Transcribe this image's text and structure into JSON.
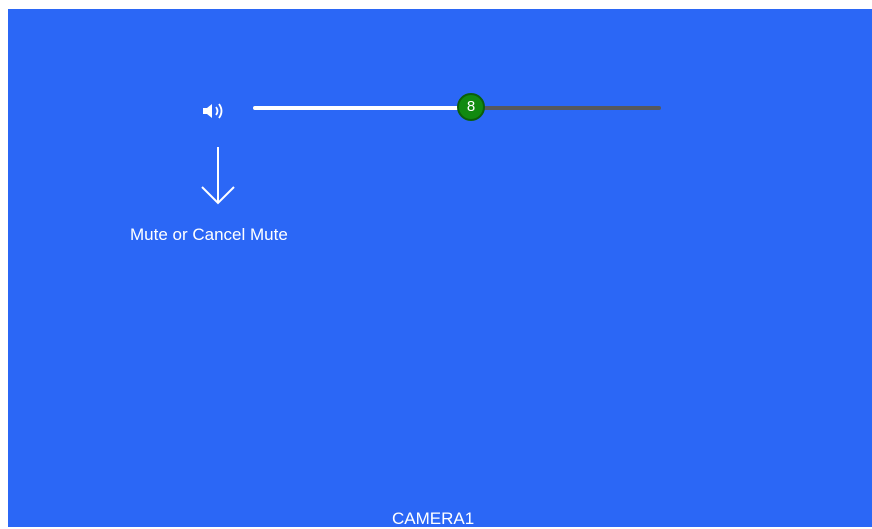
{
  "volume": {
    "icon": "speaker-icon",
    "level": 8,
    "max": 15,
    "thumb_color": "#118a10",
    "fill_color": "#ffffff",
    "track_color": "#55585d"
  },
  "hint": {
    "text": "Mute or Cancel Mute",
    "icon": "arrow-down-icon"
  },
  "camera": {
    "label": "CAMERA1"
  },
  "colors": {
    "background": "#2b67f6"
  }
}
